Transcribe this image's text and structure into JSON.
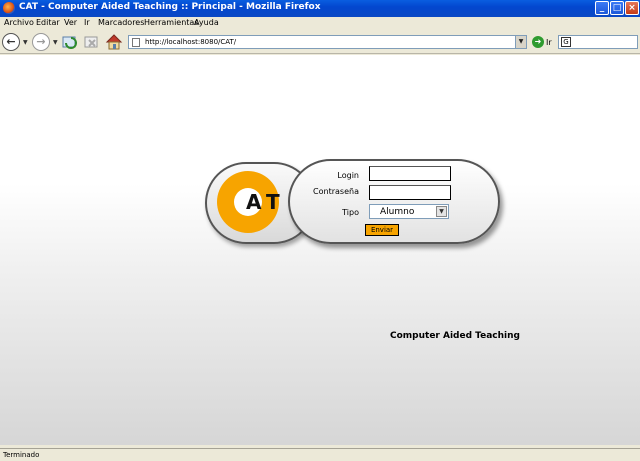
{
  "window": {
    "title": "CAT - Computer Aided Teaching :: Principal - Mozilla Firefox",
    "minimize_icon": "minimize-icon",
    "maximize_icon": "maximize-icon",
    "close_icon": "close-icon"
  },
  "menu": {
    "items": [
      {
        "label": "Archivo"
      },
      {
        "label": "Editar"
      },
      {
        "label": "Ver"
      },
      {
        "label": "Ir"
      },
      {
        "label": "Marcadores"
      },
      {
        "label": "Herramientas"
      },
      {
        "label": "Ayuda"
      }
    ]
  },
  "toolbar": {
    "url": "http://localhost:8080/CAT/",
    "go_label": "Ir",
    "back_icon": "back-arrow-icon",
    "forward_icon": "forward-arrow-icon",
    "reload_icon": "reload-icon",
    "stop_icon": "stop-icon",
    "home_icon": "home-icon"
  },
  "login": {
    "logo_letters": [
      "A",
      "T"
    ],
    "login_label": "Login",
    "password_label": "Contraseña",
    "tipo_label": "Tipo",
    "tipo_value": "Alumno",
    "submit_label": "Enviar",
    "login_value": "",
    "password_value": ""
  },
  "footer": {
    "text": "Computer Aided Teaching"
  },
  "status": {
    "text": "Terminado"
  },
  "colors": {
    "accent": "#f7a400",
    "titlebar": "#0347cf"
  }
}
